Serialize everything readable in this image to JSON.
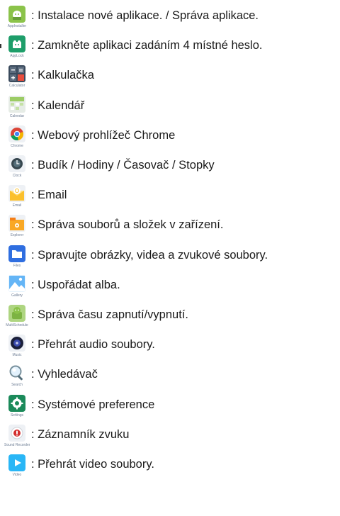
{
  "apps": [
    {
      "caption": "AppInstaller",
      "description": ": Instalace nové aplikace. / Správa aplikace.",
      "icon": "app-installer-icon"
    },
    {
      "caption": "AppLock",
      "description": ": Zamkněte aplikaci zadáním 4 místné heslo.",
      "icon": "app-lock-icon"
    },
    {
      "caption": "Calculator",
      "description": ": Kalkulačka",
      "icon": "calculator-icon"
    },
    {
      "caption": "Calendar",
      "description": ": Kalendář",
      "icon": "calendar-icon"
    },
    {
      "caption": "Chrome",
      "description": ": Webový prohlížeč Chrome",
      "icon": "chrome-icon"
    },
    {
      "caption": "Clock",
      "description": ": Budík / Hodiny / Časovač / Stopky",
      "icon": "clock-icon"
    },
    {
      "caption": "Email",
      "description": ": Email",
      "icon": "email-icon"
    },
    {
      "caption": "Explorer",
      "description": ": Správa souborů a složek v zařízení.",
      "icon": "explorer-icon"
    },
    {
      "caption": "Files",
      "description": ": Spravujte obrázky, videa a zvukové soubory.",
      "icon": "files-icon"
    },
    {
      "caption": "Gallery",
      "description": ": Uspořádat alba.",
      "icon": "gallery-icon"
    },
    {
      "caption": "MultiSchedule",
      "description": ": Správa času zapnutí/vypnutí.",
      "icon": "schedule-icon"
    },
    {
      "caption": "Music",
      "description": ": Přehrát audio soubory.",
      "icon": "music-icon"
    },
    {
      "caption": "Search",
      "description": ": Vyhledávač",
      "icon": "search-icon"
    },
    {
      "caption": "Settings",
      "description": ": Systémové preference",
      "icon": "settings-icon"
    },
    {
      "caption": "Sound Recorder",
      "description": ": Záznamník zvuku",
      "icon": "sound-recorder-icon"
    },
    {
      "caption": "Video",
      "description": ": Přehrát video soubory.",
      "icon": "video-icon"
    }
  ]
}
